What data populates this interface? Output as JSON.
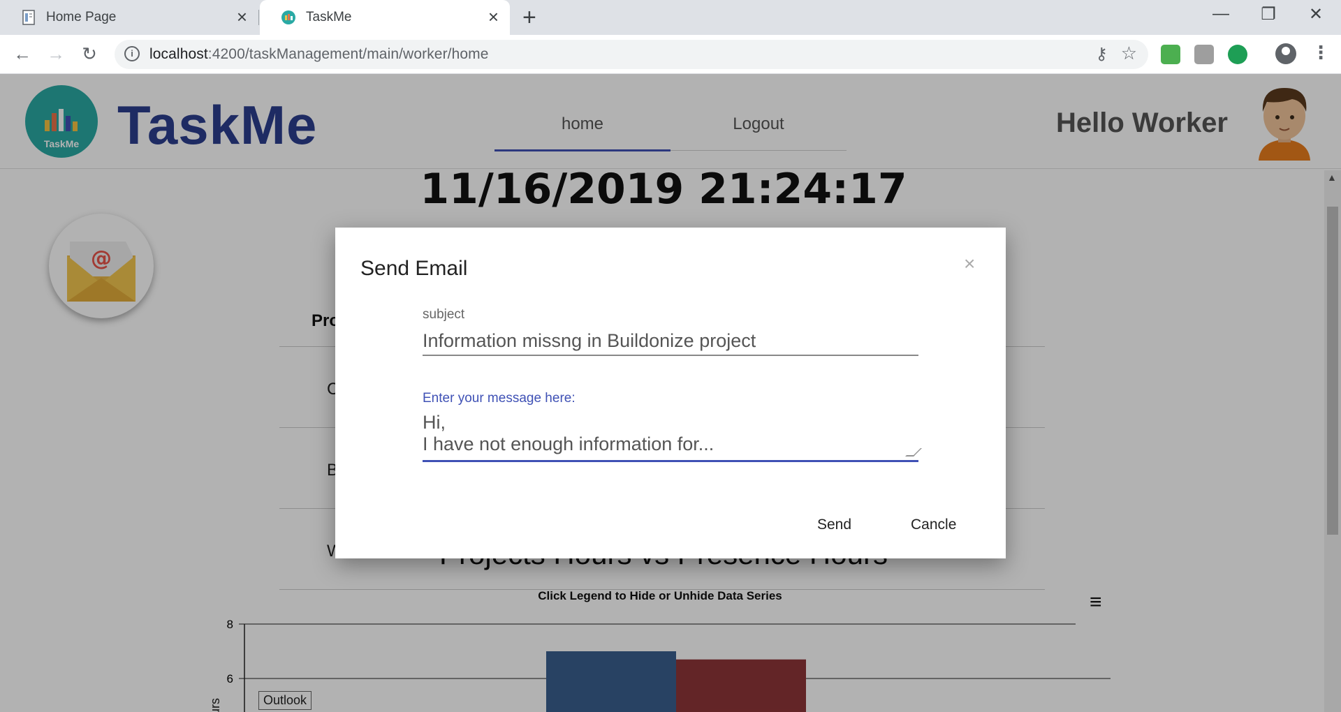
{
  "browser": {
    "tabs": [
      {
        "title": "Home Page",
        "active": false
      },
      {
        "title": "TaskMe",
        "active": true
      }
    ],
    "url_host": "localhost",
    "url_path": ":4200/taskManagement/main/worker/home"
  },
  "header": {
    "logo_text": "TaskMe",
    "brand": "TaskMe",
    "nav": {
      "home": "home",
      "logout": "Logout"
    },
    "greeting": "Hello Worker"
  },
  "main": {
    "datetime": "11/16/2019 21:24:17",
    "table_header": "Pro",
    "rows": [
      "C",
      "B",
      "W"
    ],
    "chart_title": "Projects Hours vs Presence Hours",
    "chart_subtitle": "Click Legend to Hide or Unhide Data Series",
    "ylabel_partial": "urs"
  },
  "chart_data": {
    "type": "bar",
    "title": "Projects Hours vs Presence Hours",
    "subtitle": "Click Legend to Hide or Unhide Data Series",
    "y_ticks": [
      8,
      6
    ],
    "ylim": [
      0,
      8
    ],
    "series": [
      {
        "values": [
          7
        ],
        "color": "#3a5f8f"
      },
      {
        "values": [
          6.7
        ],
        "color": "#8f3538"
      }
    ],
    "legend_visible": [
      "Outlook"
    ]
  },
  "modal": {
    "title": "Send Email",
    "close": "×",
    "subject_label": "subject",
    "subject_value": "Information missng in Buildonize project",
    "message_label": "Enter your message here:",
    "message_value": "Hi,\nI have not enough information for...",
    "send": "Send",
    "cancel": "Cancle"
  }
}
